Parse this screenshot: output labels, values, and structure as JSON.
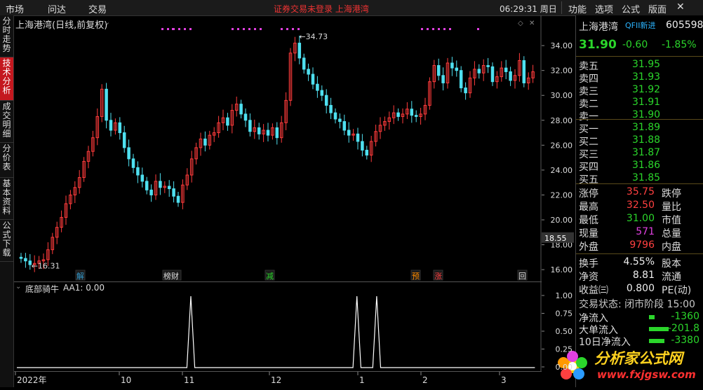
{
  "topbar": {
    "menu_left": [
      "市场",
      "问达",
      "交易"
    ],
    "status_text": "证券交易未登录 上海港湾",
    "time": "06:29:31",
    "weekday": "周日",
    "menu_right": [
      "功能",
      "选项",
      "公式",
      "版面"
    ],
    "close": "✕"
  },
  "left_tabs": [
    {
      "label": "分时走势",
      "active": false
    },
    {
      "label": "技术分析",
      "active": true
    },
    {
      "label": "成交明细",
      "active": false
    },
    {
      "label": "分价表",
      "active": false
    },
    {
      "label": "基本资料",
      "active": false
    },
    {
      "label": "公式下载",
      "active": false
    }
  ],
  "chart_header": {
    "title": "上海港湾(日线,前复权)"
  },
  "chart_data": [
    {
      "type": "candlestick",
      "title": "上海港湾(日线,前复权)",
      "ylim": [
        15.5,
        35.3
      ],
      "y_ticks": [
        16.0,
        18.0,
        20.0,
        22.0,
        24.0,
        26.0,
        28.0,
        30.0,
        32.0,
        34.0
      ],
      "high_label": "34.73",
      "low_label": "16.31",
      "crosshair_price": "18.55",
      "x_labels": [
        "2022年",
        "10",
        "11",
        "12",
        "1",
        "2",
        "3"
      ],
      "event_tags": [
        "解",
        "榜财",
        "减",
        "预",
        "涨",
        "回"
      ],
      "close": [
        16.9,
        16.7,
        16.4,
        16.5,
        16.7,
        16.8,
        17.6,
        18.6,
        19.4,
        20.2,
        21.3,
        22.0,
        22.6,
        23.4,
        24.7,
        25.5,
        26.6,
        28.3,
        30.5,
        28.0,
        27.2,
        27.8,
        27.0,
        25.8,
        24.9,
        24.2,
        23.6,
        23.1,
        22.4,
        22.0,
        23.1,
        22.6,
        22.7,
        22.5,
        21.9,
        21.4,
        22.8,
        23.6,
        24.9,
        25.8,
        26.5,
        26.0,
        26.8,
        27.0,
        27.8,
        28.2,
        27.6,
        28.8,
        29.3,
        28.5,
        28.0,
        27.1,
        27.4,
        26.9,
        27.2,
        26.8,
        27.4,
        26.6,
        27.8,
        29.6,
        33.4,
        34.2,
        33.0,
        32.1,
        31.7,
        30.9,
        30.4,
        30.0,
        29.2,
        28.6,
        28.1,
        27.9,
        27.2,
        26.8,
        26.9,
        26.3,
        25.6,
        25.2,
        26.3,
        27.1,
        27.6,
        27.9,
        28.2,
        28.6,
        28.3,
        28.5,
        28.9,
        28.4,
        28.3,
        28.5,
        29.2,
        31.1,
        32.4,
        31.6,
        31.0,
        32.6,
        32.2,
        32.0,
        30.6,
        30.2,
        31.4,
        32.1,
        31.8,
        32.4,
        32.3,
        31.1,
        31.5,
        32.2,
        31.9,
        31.2,
        31.6,
        32.8,
        31.0,
        31.4,
        31.9
      ],
      "open": [
        17.0,
        16.9,
        16.7,
        16.4,
        16.5,
        16.7,
        16.8,
        17.6,
        18.6,
        19.4,
        20.2,
        21.3,
        22.0,
        22.6,
        23.4,
        24.7,
        25.5,
        26.6,
        28.3,
        30.5,
        28.0,
        27.2,
        27.8,
        27.0,
        25.8,
        24.9,
        24.2,
        23.6,
        23.1,
        22.4,
        22.0,
        23.1,
        22.6,
        22.7,
        22.5,
        21.9,
        21.4,
        22.8,
        23.6,
        24.9,
        25.8,
        26.5,
        26.0,
        26.8,
        27.0,
        27.8,
        28.2,
        27.6,
        28.8,
        29.3,
        28.5,
        28.0,
        27.1,
        27.4,
        26.9,
        27.2,
        26.8,
        27.4,
        26.6,
        27.8,
        29.6,
        33.4,
        34.2,
        33.0,
        32.1,
        31.7,
        30.9,
        30.4,
        30.0,
        29.2,
        28.6,
        28.1,
        27.9,
        27.2,
        26.8,
        26.9,
        26.3,
        25.6,
        25.2,
        26.3,
        27.1,
        27.6,
        27.9,
        28.2,
        28.6,
        28.3,
        28.5,
        28.9,
        28.4,
        28.3,
        28.5,
        29.2,
        31.1,
        32.4,
        31.6,
        31.0,
        32.6,
        32.2,
        32.0,
        30.6,
        30.2,
        31.4,
        32.1,
        31.8,
        32.4,
        32.3,
        31.1,
        31.5,
        32.2,
        31.9,
        31.2,
        31.6,
        32.8,
        31.0,
        31.4
      ],
      "signal_marks_count": 6
    },
    {
      "type": "line",
      "title": "底部骑牛",
      "series": [
        {
          "name": "AA1",
          "last_value": "0.00"
        }
      ],
      "y_ticks": [
        0.0,
        0.25,
        0.5,
        0.75,
        1.0
      ],
      "ylim": [
        0,
        1
      ],
      "spikes_at": [
        44,
        86,
        91
      ],
      "n": 132
    }
  ],
  "indicator_header": {
    "name": "底部骑牛",
    "value_text": "AA1: 0.00"
  },
  "quote": {
    "name": "上海港湾",
    "tag": "QFII新进",
    "code": "605598",
    "price": "31.90",
    "change": "-0.60",
    "pct": "-1.85%",
    "sell": [
      {
        "label": "卖五",
        "price": "31.95"
      },
      {
        "label": "卖四",
        "price": "31.93"
      },
      {
        "label": "卖三",
        "price": "31.92"
      },
      {
        "label": "卖二",
        "price": "31.91"
      },
      {
        "label": "卖一",
        "price": "31.90"
      }
    ],
    "buy": [
      {
        "label": "买一",
        "price": "31.89"
      },
      {
        "label": "买二",
        "price": "31.88"
      },
      {
        "label": "买三",
        "price": "31.87"
      },
      {
        "label": "买四",
        "price": "31.86"
      },
      {
        "label": "买五",
        "price": "31.85"
      }
    ],
    "stats": [
      {
        "label": "涨停",
        "value": "35.75",
        "label2": "跌停",
        "color": "red"
      },
      {
        "label": "最高",
        "value": "32.50",
        "label2": "量比",
        "color": "red"
      },
      {
        "label": "最低",
        "value": "31.00",
        "label2": "市值",
        "color": "grn"
      },
      {
        "label": "现量",
        "value": "571",
        "label2": "总量",
        "color": "mag"
      },
      {
        "label": "外盘",
        "value": "9796",
        "label2": "内盘",
        "color": "red"
      }
    ],
    "stats2": [
      {
        "label": "换手",
        "value": "4.55%",
        "label2": "股本"
      },
      {
        "label": "净资",
        "value": "8.81",
        "label2": "流通"
      },
      {
        "label": "收益㈢",
        "value": "0.800",
        "label2": "PE(动)"
      }
    ],
    "trade_status": "交易状态: 闭市阶段 15:00",
    "flows": [
      {
        "label": "净流入",
        "value": "-1360"
      },
      {
        "label": "大单流入",
        "value": "-201.8"
      },
      {
        "label": "10日净流入",
        "value": "-3380"
      }
    ]
  },
  "watermark": {
    "text": "分析家公式网",
    "url": "www.fxjgsw.com"
  }
}
